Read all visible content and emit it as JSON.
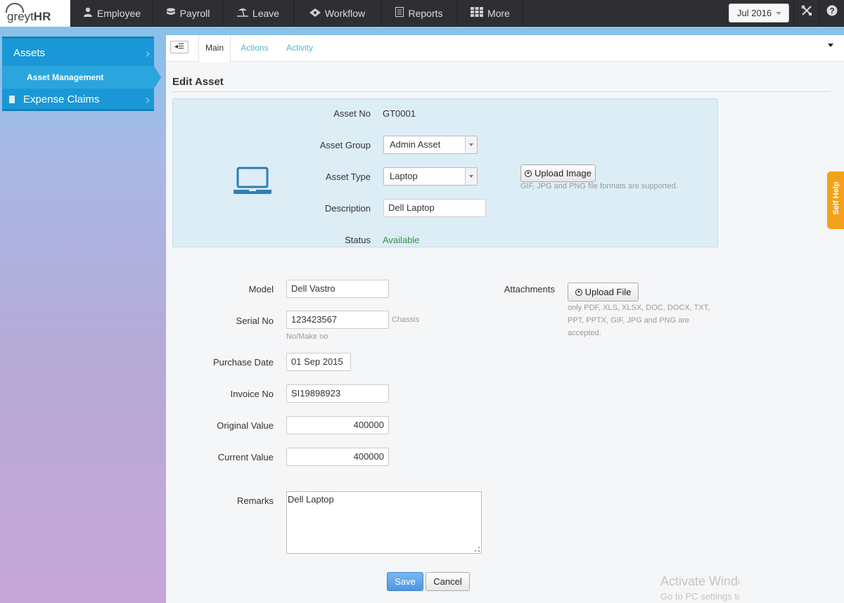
{
  "brand": {
    "name_light": "greyt",
    "name_bold": "HR"
  },
  "nav": {
    "items": [
      {
        "label": "Employee",
        "icon": "user-icon"
      },
      {
        "label": "Payroll",
        "icon": "coins-icon"
      },
      {
        "label": "Leave",
        "icon": "beach-icon"
      },
      {
        "label": "Workflow",
        "icon": "workflow-icon"
      },
      {
        "label": "Reports",
        "icon": "report-icon"
      },
      {
        "label": "More",
        "icon": "grid-icon"
      }
    ],
    "period": "Jul 2016"
  },
  "sidebar": {
    "section": "Assets",
    "sub_item": "Asset Management",
    "next_section": "Expense Claims"
  },
  "tabs": [
    "Main",
    "Actions",
    "Activity"
  ],
  "page_title": "Edit Asset",
  "asset": {
    "labels": {
      "asset_no": "Asset No",
      "asset_group": "Asset Group",
      "asset_type": "Asset Type",
      "description": "Description",
      "status": "Status"
    },
    "asset_no": "GT0001",
    "asset_group": "Admin Asset",
    "asset_type": "Laptop",
    "description": "Dell Laptop",
    "status": "Available",
    "upload_image_label": "Upload Image",
    "upload_image_hint": "GIF, JPG and PNG file formats are supported."
  },
  "details": {
    "labels": {
      "model": "Model",
      "serial_no": "Serial No",
      "purchase_date": "Purchase Date",
      "invoice_no": "Invoice No",
      "original_value": "Original Value",
      "current_value": "Current Value",
      "remarks": "Remarks",
      "attachments": "Attachments"
    },
    "model": "Dell Vastro",
    "serial_no": "123423567",
    "serial_hint_a": "Chassis",
    "serial_hint_b": "No/Make no",
    "purchase_date": "01 Sep 2015",
    "invoice_no": "SI19898923",
    "original_value": "400000",
    "current_value": "400000",
    "remarks": "Dell Laptop",
    "upload_file_label": "Upload File",
    "attachment_hint_1": "only PDF, XLS, XLSX, DOC, DOCX, TXT,",
    "attachment_hint_2": "PPT, PPTX, GIF, JPG and PNG are",
    "attachment_hint_3": "accepted."
  },
  "actions": {
    "save": "Save",
    "cancel": "Cancel"
  },
  "self_help": "Self Help",
  "watermark": {
    "line1": "Activate Windows",
    "line2": "Go to PC settings to activate Windows."
  },
  "colors": {
    "accent_blue": "#1a97d6",
    "status_green": "#3d8d4c",
    "self_help_orange": "#f3a21d",
    "save_blue": "#4d96e0"
  }
}
